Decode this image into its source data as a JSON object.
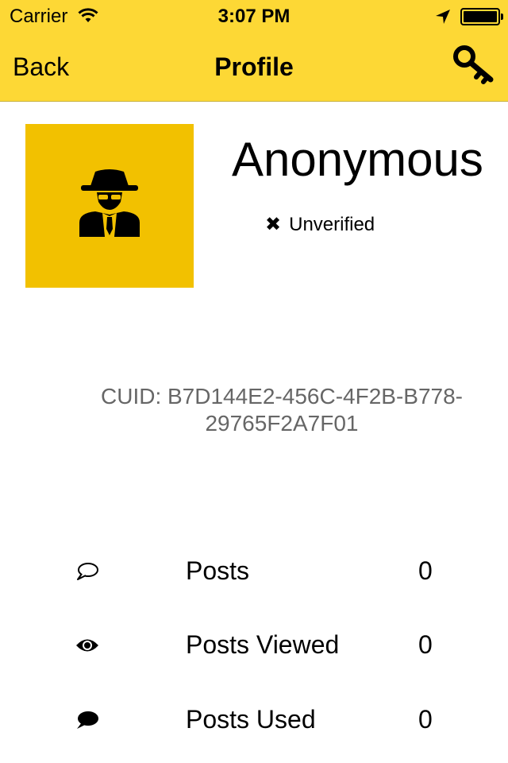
{
  "status_bar": {
    "carrier": "Carrier",
    "time": "3:07 PM"
  },
  "nav": {
    "back_label": "Back",
    "title": "Profile",
    "action_icon": "key-icon"
  },
  "colors": {
    "header": "#fdd835",
    "avatar_bg": "#f2c100",
    "cuid_text": "#666666"
  },
  "profile": {
    "avatar_icon": "spy-icon",
    "name": "Anonymous",
    "verification_mark": "✖",
    "verification_status": "Unverified",
    "cuid": "CUID: B7D144E2-456C-4F2B-B778-29765F2A7F01"
  },
  "stats": [
    {
      "icon": "speech-bubble-outline-icon",
      "label": "Posts",
      "value": "0"
    },
    {
      "icon": "eye-icon",
      "label": "Posts Viewed",
      "value": "0"
    },
    {
      "icon": "speech-bubble-filled-icon",
      "label": "Posts Used",
      "value": "0"
    }
  ]
}
